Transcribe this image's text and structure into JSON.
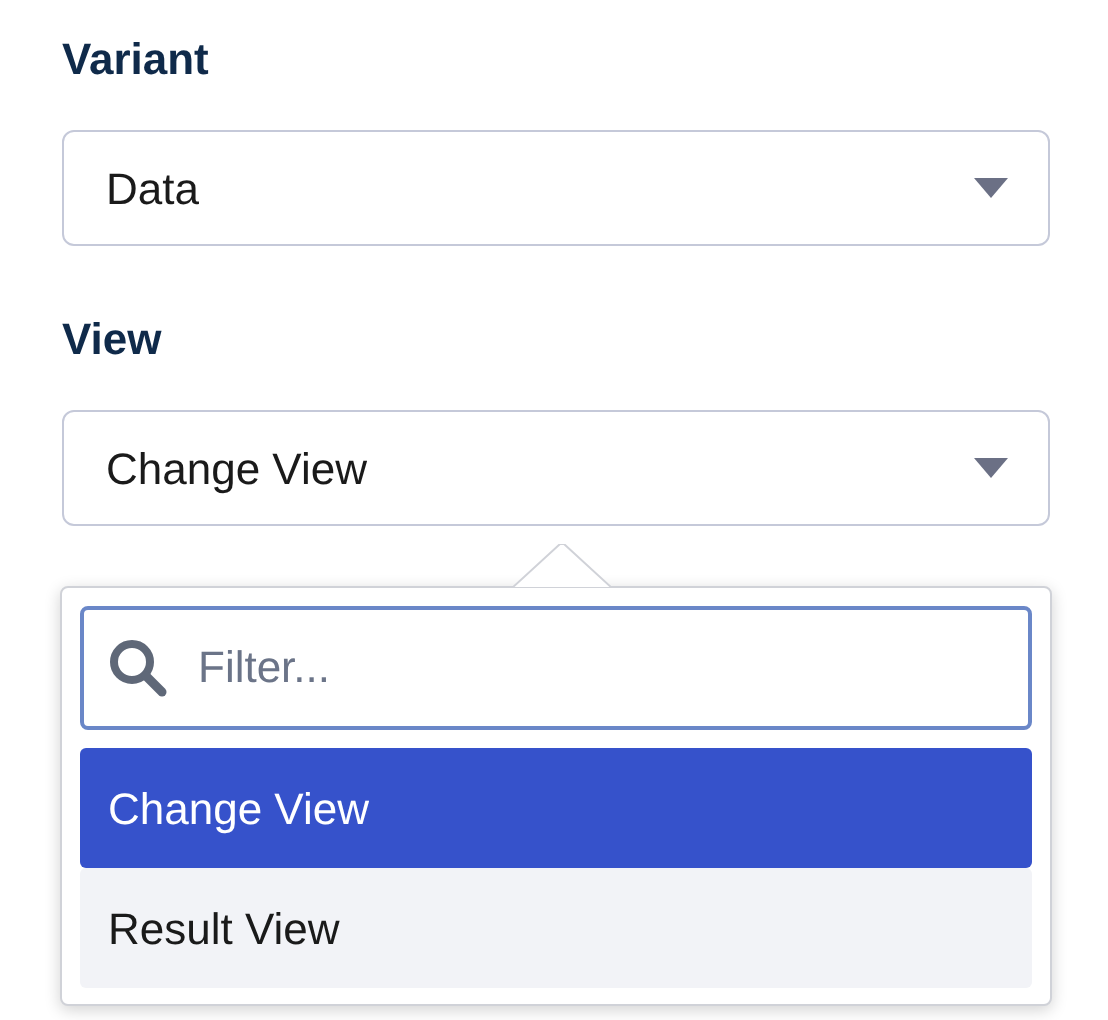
{
  "fields": [
    {
      "label": "Variant",
      "value": "Data"
    },
    {
      "label": "View",
      "value": "Change View",
      "dropdown": {
        "filter": {
          "placeholder": "Filter..."
        },
        "options": [
          {
            "label": "Change View",
            "selected": true
          },
          {
            "label": "Result View",
            "selected": false
          }
        ]
      }
    }
  ]
}
